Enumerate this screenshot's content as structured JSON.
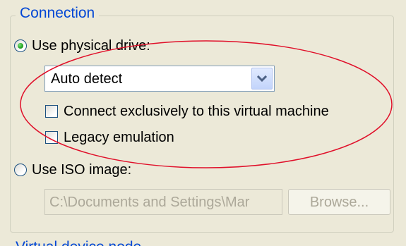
{
  "group": {
    "title": "Connection"
  },
  "physical": {
    "label": "Use physical drive:",
    "selected": true,
    "drive_value": "Auto detect",
    "exclusive_label": "Connect exclusively to this virtual machine",
    "exclusive_checked": false,
    "legacy_label": "Legacy emulation",
    "legacy_checked": false
  },
  "iso": {
    "label": "Use ISO image:",
    "selected": false,
    "path_value": "C:\\Documents and Settings\\Mar",
    "browse_label": "Browse..."
  },
  "next_group": {
    "title": "Virtual device node"
  },
  "colors": {
    "annotation": "#E0102A",
    "legend": "#0046D5",
    "panel": "#ECE9D8"
  },
  "icons": {
    "dropdown": "chevron-down-icon"
  }
}
